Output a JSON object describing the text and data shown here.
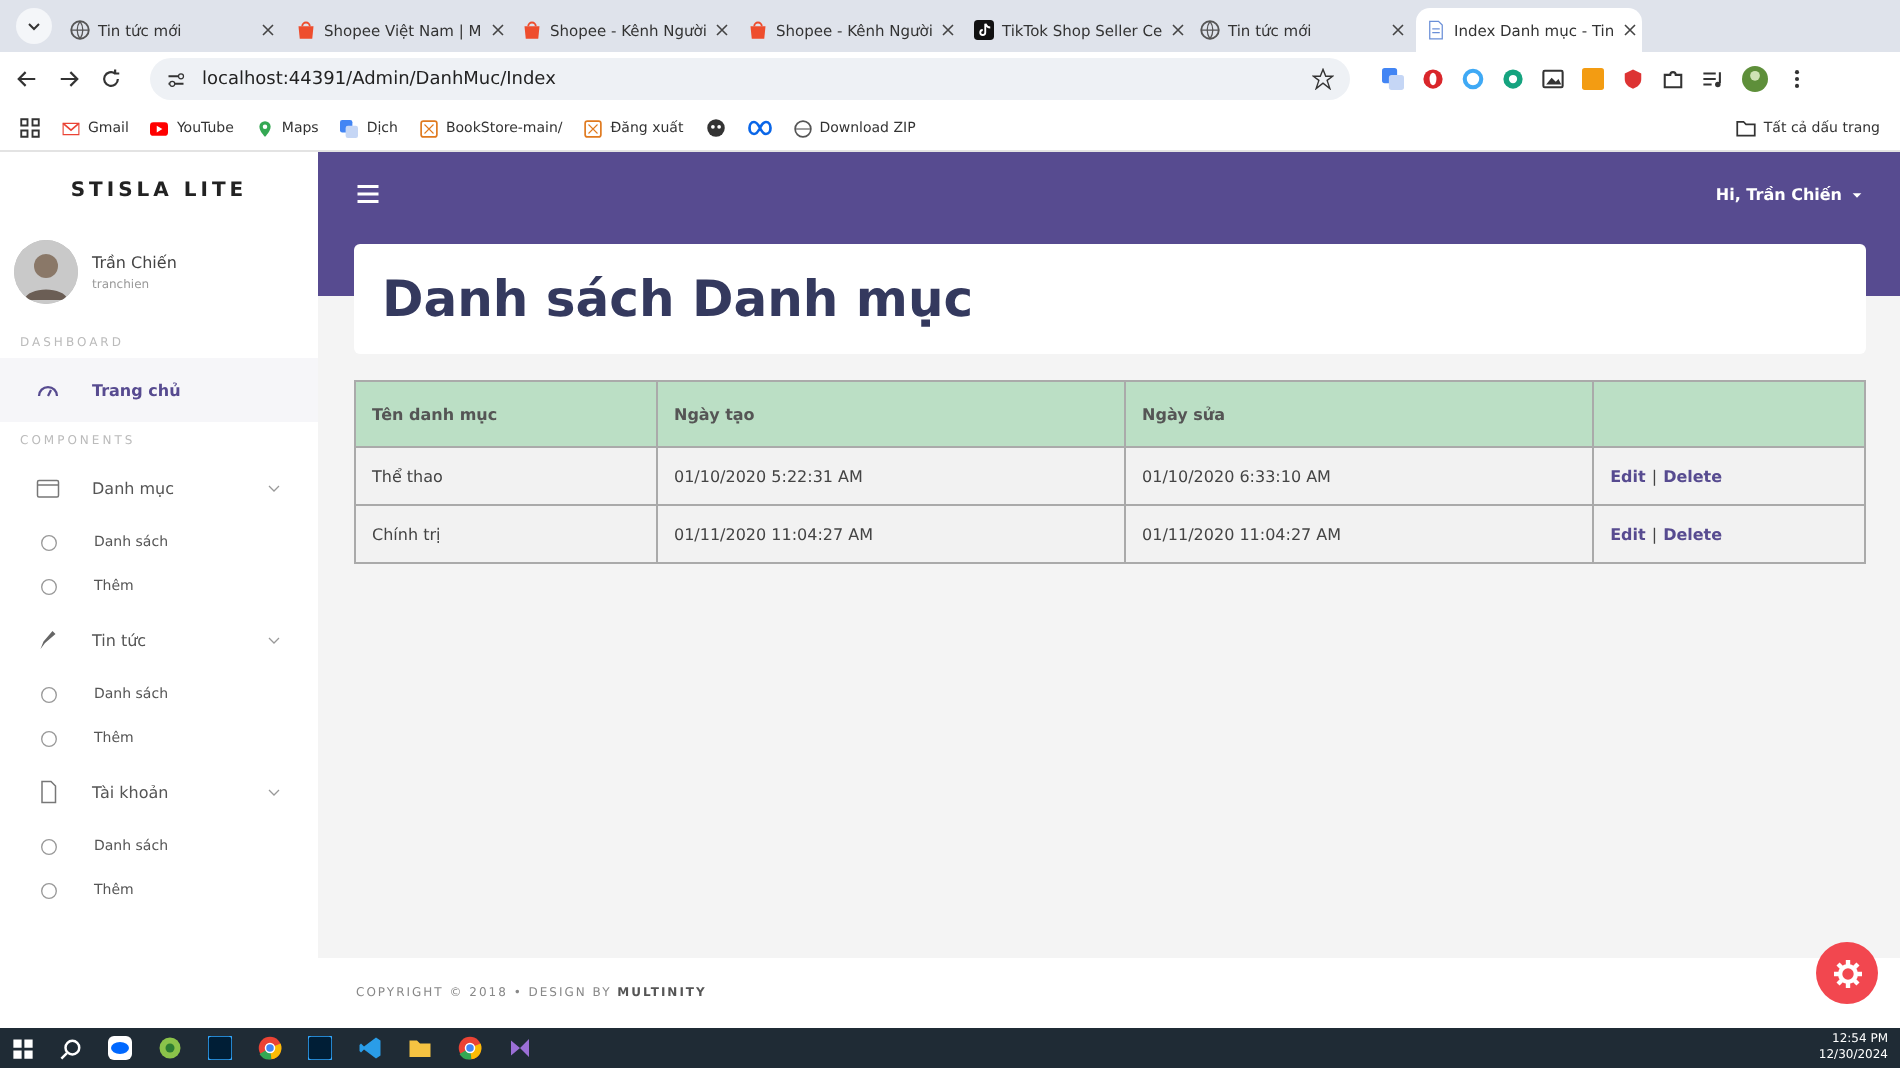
{
  "browser": {
    "tabs": [
      {
        "title": "Tin tức mới",
        "selected": false
      },
      {
        "title": "Shopee Việt Nam | M",
        "selected": false
      },
      {
        "title": "Shopee - Kênh Người",
        "selected": false
      },
      {
        "title": "Shopee - Kênh Người",
        "selected": false
      },
      {
        "title": "TikTok Shop Seller Ce",
        "selected": false
      },
      {
        "title": "Tin tức mới",
        "selected": false
      },
      {
        "title": "Index Danh mục - Tin",
        "selected": true
      }
    ],
    "url": "localhost:44391/Admin/DanhMuc/Index",
    "bookmarks": [
      "Gmail",
      "YouTube",
      "Maps",
      "Dịch",
      "BookStore-main/",
      "Đăng xuất",
      "Download ZIP"
    ],
    "all_bookmarks": "Tất cả dấu trang"
  },
  "sidebar": {
    "brand": "STISLA LITE",
    "user": {
      "name": "Trần Chiến",
      "username": "tranchien"
    },
    "sections": [
      {
        "header": "DASHBOARD",
        "items": [
          {
            "label": "Trang chủ",
            "selected": true
          }
        ]
      },
      {
        "header": "COMPONENTS",
        "items": [
          {
            "label": "Danh mục",
            "selected": false,
            "expanded": true,
            "children": [
              {
                "label": "Danh sách"
              },
              {
                "label": "Thêm"
              }
            ]
          },
          {
            "label": "Tin tức",
            "selected": false,
            "expanded": true,
            "children": [
              {
                "label": "Danh sách"
              },
              {
                "label": "Thêm"
              }
            ]
          },
          {
            "label": "Tài khoản",
            "selected": false,
            "expanded": true,
            "children": [
              {
                "label": "Danh sách"
              },
              {
                "label": "Thêm"
              }
            ]
          }
        ]
      }
    ]
  },
  "navbar": {
    "greeting": "Hi, Trần Chiến"
  },
  "page": {
    "title": "Danh sách Danh mục"
  },
  "table": {
    "columns": [
      "Tên danh mục",
      "Ngày tạo",
      "Ngày sửa"
    ],
    "rows": [
      {
        "cells": [
          "Thể thao",
          "01/10/2020 5:22:31 AM",
          "01/10/2020 6:33:10 AM"
        ],
        "actions": [
          "Edit",
          "Delete"
        ]
      },
      {
        "cells": [
          "Chính trị",
          "01/11/2020 11:04:27 AM",
          "01/11/2020 11:04:27 AM"
        ],
        "actions": [
          "Edit",
          "Delete"
        ]
      }
    ],
    "action_separator": "|"
  },
  "footer": "COPYRIGHT © 2018  •  DESIGN BY **MULTINITY**",
  "taskbar": {
    "time": "12:54 PM",
    "date": "12/30/2024"
  }
}
